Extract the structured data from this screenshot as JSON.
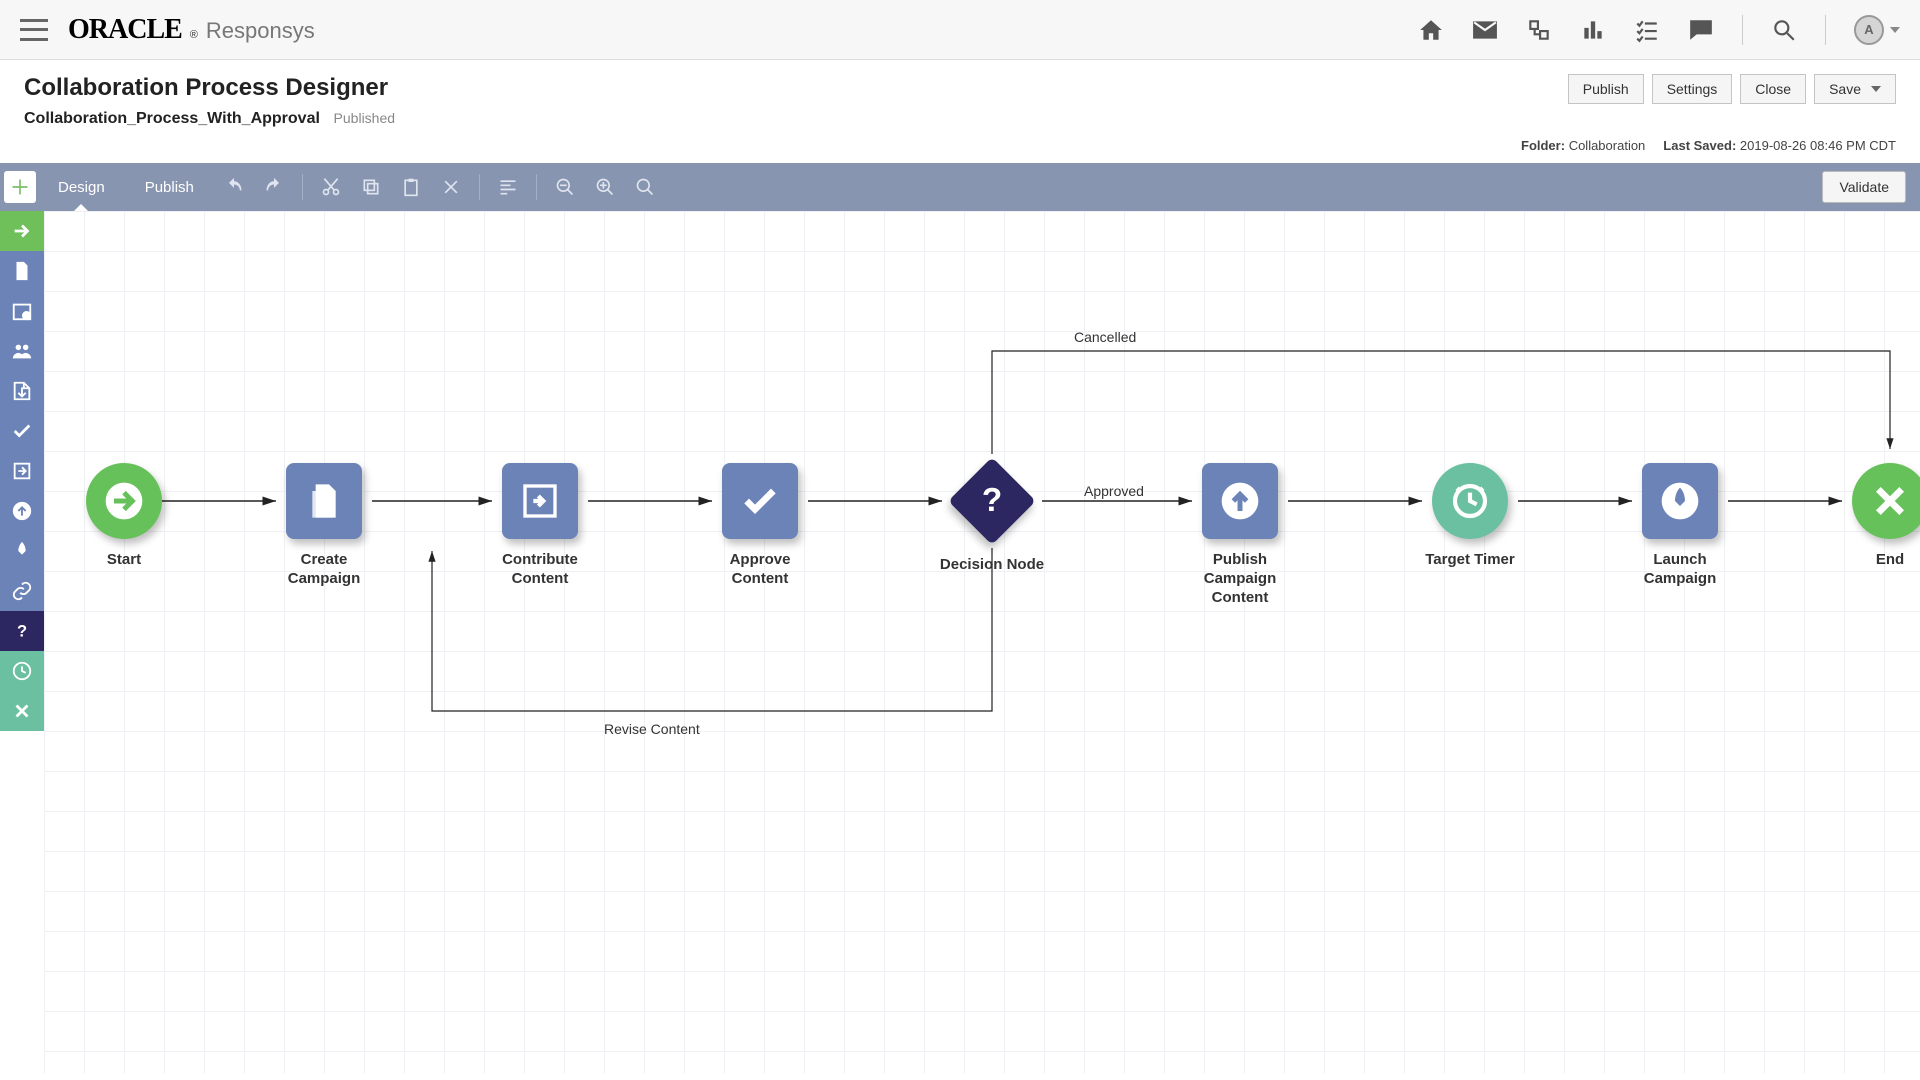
{
  "brand": {
    "logo": "ORACLE",
    "product": "Responsys"
  },
  "avatar": {
    "initial": "A"
  },
  "page": {
    "title": "Collaboration Process Designer",
    "process_name": "Collaboration_Process_With_Approval",
    "status": "Published"
  },
  "actions": {
    "publish": "Publish",
    "settings": "Settings",
    "close": "Close",
    "save": "Save"
  },
  "meta": {
    "folder_label": "Folder:",
    "folder_value": "Collaboration",
    "last_saved_label": "Last Saved:",
    "last_saved_value": "2019-08-26 08:46 PM CDT"
  },
  "toolbar": {
    "design": "Design",
    "publish": "Publish",
    "validate": "Validate"
  },
  "nodes": {
    "start": "Start",
    "create": "Create Campaign",
    "contribute": "Contribute Content",
    "approve": "Approve Content",
    "decision": "Decision Node",
    "publish_content": "Publish Campaign Content",
    "timer": "Target Timer",
    "launch": "Launch Campaign",
    "end": "End"
  },
  "edges": {
    "approved": "Approved",
    "cancelled": "Cancelled",
    "revise": "Revise Content"
  }
}
